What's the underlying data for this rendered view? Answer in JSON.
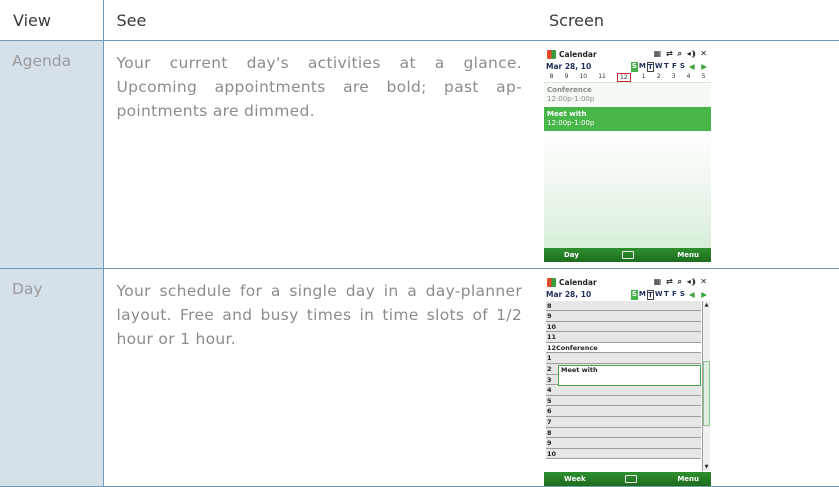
{
  "table": {
    "headers": {
      "view": "View",
      "see": "See",
      "screen": "Screen"
    },
    "rows": [
      {
        "view": "Agenda",
        "see": "Your current day's activities at a glance. Upcoming appointments are bold; past ap-pointments are dimmed."
      },
      {
        "view": "Day",
        "see": "Your schedule for a single day in a day-planner layout. Free and busy times in time slots of 1/2 hour or 1 hour."
      }
    ]
  },
  "agenda_screen": {
    "app": "Calendar",
    "sys_icons": "▦ ⇄ ⌕ ◂⸩ ✕",
    "date": "Mar 28, 10",
    "days": [
      "S",
      "M",
      "T",
      "W",
      "T",
      "F",
      "S"
    ],
    "nav": "◀ ▶",
    "strip": [
      "8",
      "9",
      "10",
      "11",
      "12",
      "1",
      "2",
      "3",
      "4",
      "5"
    ],
    "appointments": [
      {
        "name": "Conference",
        "time": "12:00p-1:00p"
      },
      {
        "name": "Meet with",
        "time": "12:00p-1:00p"
      }
    ],
    "left_soft": "Day",
    "right_soft": "Menu"
  },
  "day_screen": {
    "app": "Calendar",
    "sys_icons": "▦ ⇄ ⌕ ◂⸩ ✕",
    "date": "Mar 28, 10",
    "days": [
      "S",
      "M",
      "T",
      "W",
      "T",
      "F",
      "S"
    ],
    "nav": "◀ ▶",
    "hours": [
      "8",
      "9",
      "10",
      "11",
      "12",
      "1",
      "2",
      "3",
      "4",
      "5",
      "6",
      "7",
      "8",
      "9",
      "10"
    ],
    "event_conference": "Conference",
    "event_meet": "Meet with",
    "left_soft": "Week",
    "right_soft": "Menu"
  }
}
